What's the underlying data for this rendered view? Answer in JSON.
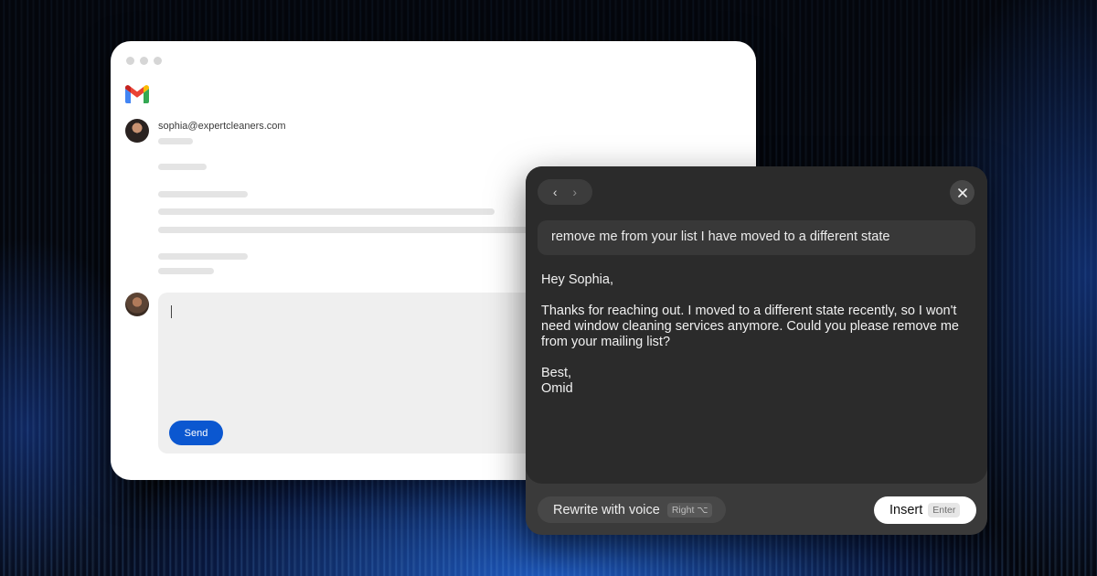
{
  "mail": {
    "sender": "sophia@expertcleaners.com",
    "send_label": "Send"
  },
  "assistant": {
    "prompt": "remove me from your list I have moved to a different state",
    "reply": {
      "greeting": "Hey Sophia,",
      "body": "Thanks for reaching out. I moved to a different state recently, so I won't need window cleaning services anymore. Could you please remove me from your mailing list?",
      "closing": "Best,",
      "signature": "Omid"
    },
    "rewrite_label": "Rewrite with voice",
    "rewrite_shortcut": "Right ⌥",
    "insert_label": "Insert",
    "insert_shortcut": "Enter"
  },
  "colors": {
    "send_button": "#0b57d0",
    "panel_bg": "#2b2b2b",
    "panel_footer": "#3a3a3a"
  },
  "icons": [
    "gmail-logo",
    "back-arrow-icon",
    "forward-arrow-icon",
    "close-icon"
  ]
}
